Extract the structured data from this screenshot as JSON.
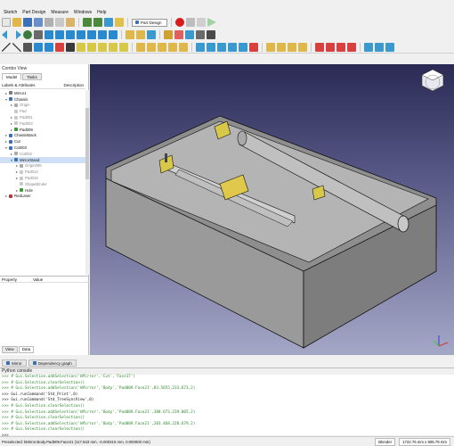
{
  "menu": [
    "Sketch",
    "Part Design",
    "Measure",
    "Windows",
    "Help"
  ],
  "workbench": "Part Design",
  "combo": {
    "title": "Combo View",
    "tabs": [
      "Model",
      "Tasks"
    ],
    "columns": {
      "labels": "Labels & Attributes",
      "description": "Description"
    },
    "tree": [
      {
        "label": "Mirror1",
        "indent": 1,
        "color": "#7a7a7a",
        "arrow": ">"
      },
      {
        "label": "Chassis",
        "indent": 1,
        "color": "#3b6fb6",
        "arrow": "v"
      },
      {
        "label": "Origin",
        "indent": 2,
        "color": "#aaaaaa",
        "arrow": ">",
        "dim": true
      },
      {
        "label": "Pad",
        "indent": 2,
        "color": "#c9c9c9",
        "arrow": "",
        "dim": true
      },
      {
        "label": "Pad001",
        "indent": 2,
        "color": "#c9c9c9",
        "arrow": ">",
        "dim": true
      },
      {
        "label": "Pad002",
        "indent": 2,
        "color": "#c9c9c9",
        "arrow": ">",
        "dim": true
      },
      {
        "label": "Pad009",
        "indent": 2,
        "color": "#3a9a3a",
        "arrow": ">"
      },
      {
        "label": "ChassisBack",
        "indent": 1,
        "color": "#3b6fb6",
        "arrow": ">"
      },
      {
        "label": "Cut",
        "indent": 1,
        "color": "#3b6fb6",
        "arrow": ">"
      },
      {
        "label": "Cut003",
        "indent": 1,
        "color": "#3b6fb6",
        "arrow": "v"
      },
      {
        "label": "Cut002",
        "indent": 2,
        "color": "#aaaaaa",
        "arrow": ">",
        "dim": true
      },
      {
        "label": "MirrorStand",
        "indent": 2,
        "color": "#3b6fb6",
        "arrow": "v",
        "selected": true
      },
      {
        "label": "Origin006",
        "indent": 3,
        "color": "#aaaaaa",
        "arrow": ">",
        "dim": true
      },
      {
        "label": "Pad014",
        "indent": 3,
        "color": "#c9c9c9",
        "arrow": ">",
        "dim": true
      },
      {
        "label": "Pad015",
        "indent": 3,
        "color": "#c9c9c9",
        "arrow": ">",
        "dim": true
      },
      {
        "label": "ShapeBinder",
        "indent": 3,
        "color": "#c9c9c9",
        "arrow": "",
        "dim": true
      },
      {
        "label": "Hole",
        "indent": 3,
        "color": "#3a9a3a",
        "arrow": ">"
      },
      {
        "label": "RedLaser",
        "indent": 1,
        "color": "#b33",
        "arrow": ">"
      }
    ],
    "props": {
      "property": "Property",
      "value": "Value"
    },
    "bottom_tabs": [
      "View",
      "Data"
    ]
  },
  "doc_tabs": [
    "Mirror",
    "Dependency graph"
  ],
  "console": {
    "title": "Python console",
    "lines": [
      {
        "text": ">>> # Gui.Selection.addSelection('kMirror','Cut','Face17')",
        "style": "c-green"
      },
      {
        "text": ">>> # Gui.Selection.clearSelection()",
        "style": "c-green"
      },
      {
        "text": ">>> # Gui.Selection.addSelection('kMirror','Body','Pad009.Face21',83.5655,233.673,2)",
        "style": "c-green"
      },
      {
        "text": ">>> Gui.runCommand('Std_Print',0)",
        "style": "c-dark"
      },
      {
        "text": ">>> Gui.runCommand('Std_TreeSyncView',0)",
        "style": "c-dark"
      },
      {
        "text": ">>> # Gui.Selection.clearSelection()",
        "style": "c-green"
      },
      {
        "text": ">>> # Gui.Selection.addSelection('kMirror','Body','Pad009.Face21',388.673,239.005,2)",
        "style": "c-green"
      },
      {
        "text": ">>> # Gui.Selection.clearSelection()",
        "style": "c-green"
      },
      {
        "text": ">>> # Gui.Selection.addSelection('kMirror','Body','Pad009.Face21',283.468,228.679,2)",
        "style": "c-green"
      },
      {
        "text": ">>> # Gui.Selection.clearSelection()",
        "style": "c-green"
      },
      {
        "text": ">>>",
        "style": "c-dark"
      }
    ]
  },
  "status": {
    "left": "Preselected: kMirror.Body.Pad009.Face21 (117.843 mm, -0.000315 mm, 0.000000 mm)",
    "nav_style": "Blender",
    "dimensions": "1722.76 mm x 905.79 mm"
  }
}
